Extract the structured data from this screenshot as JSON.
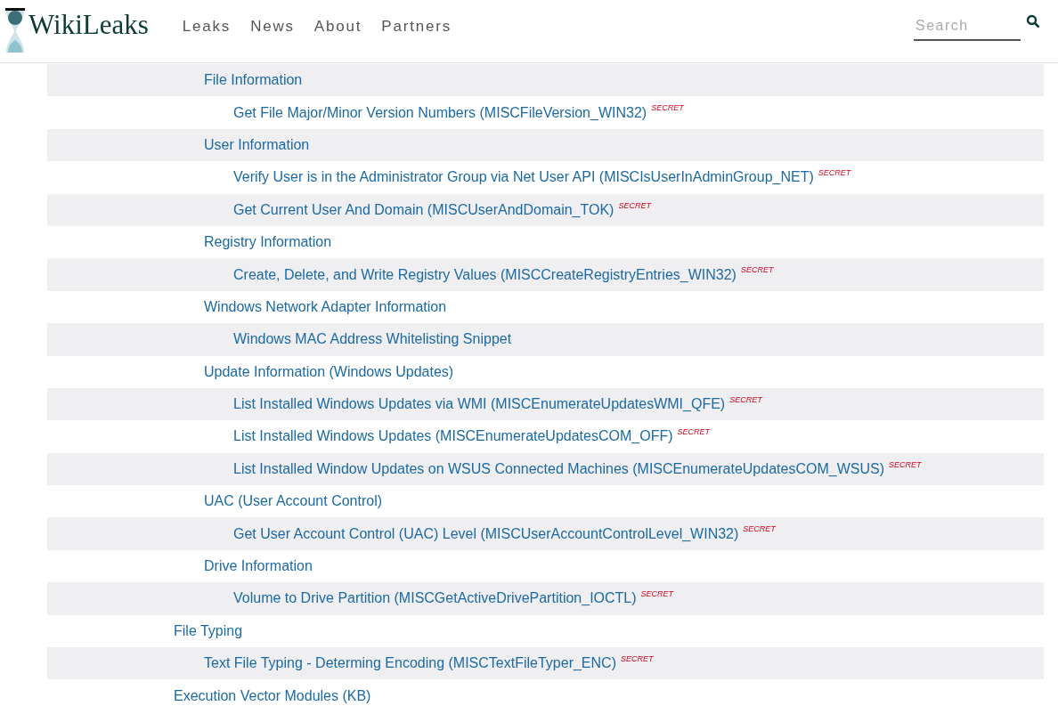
{
  "header": {
    "logo": "WikiLeaks",
    "nav": [
      {
        "label": "Leaks"
      },
      {
        "label": "News"
      },
      {
        "label": "About"
      },
      {
        "label": "Partners"
      }
    ],
    "search": {
      "placeholder": "Search"
    }
  },
  "tree": [
    {
      "children": [
        {
          "label": "File Information",
          "children": [
            {
              "label": "Get File Major/Minor Version Numbers (MISCFileVersion_WIN32)",
              "tag": "SECRET"
            }
          ]
        },
        {
          "label": "User Information",
          "children": [
            {
              "label": "Verify User is in the Administrator Group via Net User API (MISCIsUserInAdminGroup_NET)",
              "tag": "SECRET"
            },
            {
              "label": "Get Current User And Domain (MISCUserAndDomain_TOK)",
              "tag": "SECRET"
            }
          ]
        },
        {
          "label": "Registry Information",
          "children": [
            {
              "label": "Create, Delete, and Write Registry Values (MISCCreateRegistryEntries_WIN32)",
              "tag": "SECRET"
            }
          ]
        },
        {
          "label": "Windows Network Adapter Information",
          "children": [
            {
              "label": "Windows MAC Address Whitelisting Snippet"
            }
          ]
        },
        {
          "label": "Update Information (Windows Updates)",
          "children": [
            {
              "label": "List Installed Windows Updates via WMI (MISCEnumerateUpdatesWMI_QFE)",
              "tag": "SECRET"
            },
            {
              "label": "List Installed Windows Updates (MISCEnumerateUpdatesCOM_OFF)",
              "tag": "SECRET"
            },
            {
              "label": "List Installed Window Updates on WSUS Connected Machines (MISCEnumerateUpdatesCOM_WSUS)",
              "tag": "SECRET"
            }
          ]
        },
        {
          "label": "UAC (User Account Control)",
          "children": [
            {
              "label": "Get User Account Control (UAC) Level (MISCUserAccountControlLevel_WIN32)",
              "tag": "SECRET"
            }
          ]
        },
        {
          "label": "Drive Information",
          "children": [
            {
              "label": "Volume to Drive Partition (MISCGetActiveDrivePartition_IOCTL)",
              "tag": "SECRET"
            }
          ]
        }
      ]
    },
    {
      "label": "File Typing",
      "children": [
        {
          "label": "Text File Typing - Determing Encoding (MISCTextFileTyper_ENC)",
          "tag": "SECRET"
        }
      ]
    },
    {
      "label": "Execution Vector Modules (KB)"
    }
  ]
}
